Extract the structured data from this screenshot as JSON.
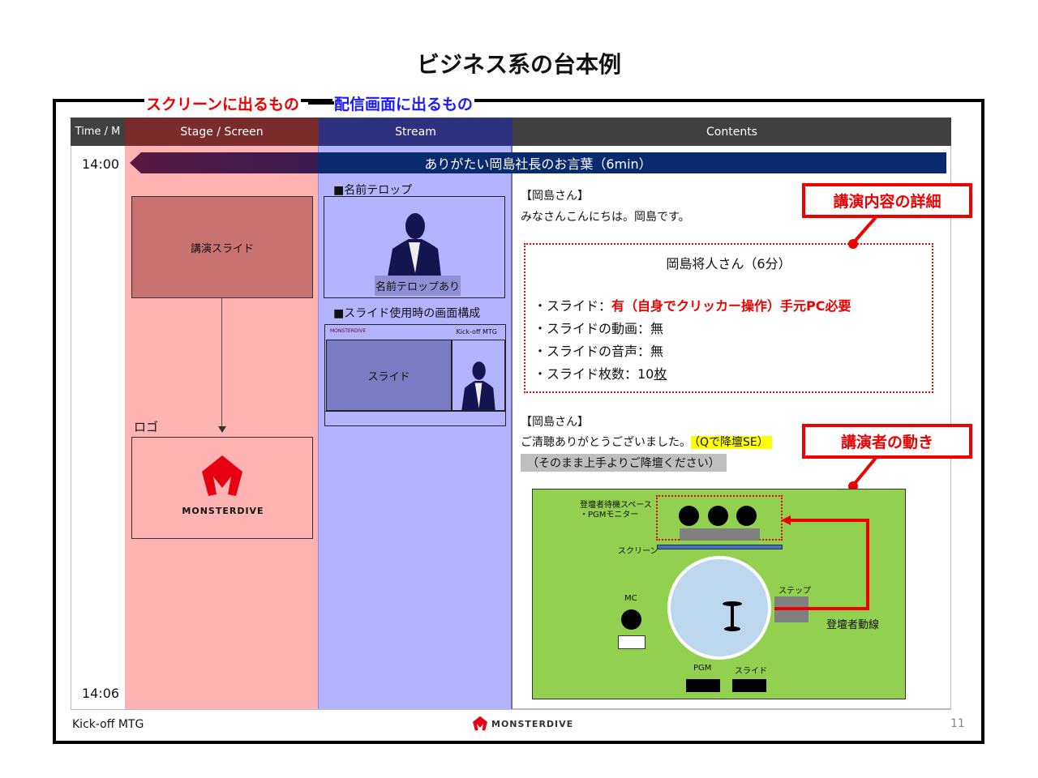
{
  "title": "ビジネス系の台本例",
  "labels": {
    "screen": "スクリーンに出るもの",
    "stream": "配信画面に出るもの"
  },
  "header": {
    "time": "Time / M",
    "stage": "Stage / Screen",
    "stream": "Stream",
    "contents": "Contents"
  },
  "times": {
    "start": "14:00",
    "end": "14:06"
  },
  "banner": "ありがたい岡島社長のお言葉（6min）",
  "stage": {
    "slide": "講演スライド",
    "logo_label": "ロゴ",
    "logo_text": "MONSTERDIVE"
  },
  "stream": {
    "section1": "■名前テロップ",
    "telop": "名前テロップあり",
    "section2": "■スライド使用時の画面構成",
    "mini_logo": "MONSTERDIVE",
    "mini_title": "Kick-off MTG",
    "slide": "スライド"
  },
  "contents": {
    "speaker1": "【岡島さん】",
    "line1": "みなさんこんにちは。岡島です。",
    "detail_title": "岡島将人さん（6分）",
    "detail_slide_prefix": "・スライド：",
    "detail_slide_value": "有（自身でクリッカー操作）手元PC必要",
    "detail_video": "・スライドの動画：無",
    "detail_audio": "・スライドの音声：無",
    "detail_count_prefix": "・スライド枚数：10",
    "detail_count_suffix": "枚",
    "speaker2": "【岡島さん】",
    "line2": "ご清聴ありがとうございました。",
    "cue": "（Qで降壇SE）",
    "note": "（そのまま上手よりご降壇ください）"
  },
  "callouts": {
    "detail": "講演内容の詳細",
    "movement": "講演者の動き"
  },
  "map": {
    "waiting": "登壇者待機スペース",
    "monitor": "・PGMモニター",
    "screen": "スクリーン",
    "step": "ステップ",
    "mc": "MC",
    "pgm": "PGM",
    "slide": "スライド",
    "route": "登壇者動線"
  },
  "footer": {
    "left": "Kick-off MTG",
    "logo": "MONSTERDIVE",
    "page": "11"
  },
  "colors": {
    "stage_bg": "#ffb3b3",
    "stream_bg": "#b3b3ff",
    "accent": "#e60012",
    "banner": "#0a2a6e",
    "map_bg": "#92d050"
  }
}
